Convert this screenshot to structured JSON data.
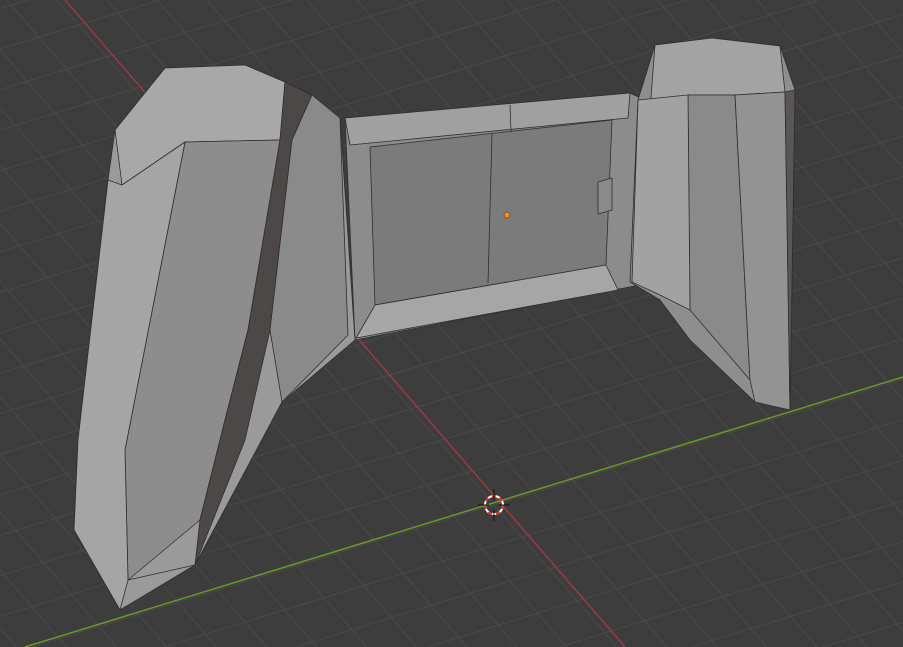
{
  "viewport": {
    "background": "#3d3d3d",
    "grid_color": "#4a4a4a",
    "x_axis_color": "#9a3a44",
    "y_axis_color": "#6a9a28",
    "origin_color": "#ff8c1a",
    "mesh_light": "#a3a3a3",
    "mesh_mid": "#8e8e8e",
    "mesh_dark": "#4a4646"
  }
}
